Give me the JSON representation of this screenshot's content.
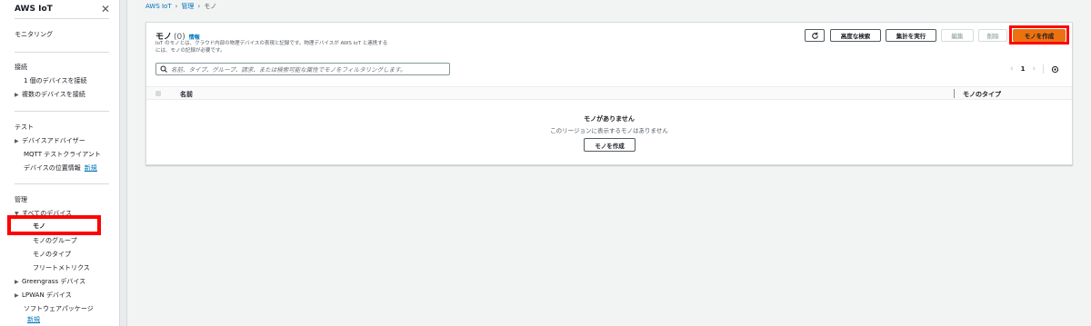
{
  "sidebar": {
    "title": "AWS IoT",
    "monitoring": "モニタリング",
    "connect": {
      "heading": "接続",
      "items": [
        "1 個のデバイスを接続",
        "複数のデバイスを接続"
      ]
    },
    "test": {
      "heading": "テスト",
      "items": [
        "デバイスアドバイザー",
        "MQTT テストクライアント",
        "デバイスの位置情報"
      ],
      "new_badge": "新規"
    },
    "manage": {
      "heading": "管理",
      "all_devices": "すべてのデバイス",
      "sub_items": [
        "モノ",
        "モノのグループ",
        "モノのタイプ",
        "フリートメトリクス"
      ],
      "greengrass": "Greengrass デバイス",
      "lpwan": "LPWAN デバイス",
      "software": "ソフトウェアパッケージ",
      "software_new": "新規"
    }
  },
  "breadcrumb": {
    "items": [
      "AWS IoT",
      "管理"
    ],
    "current": "モノ"
  },
  "panel": {
    "title": "モノ",
    "count": "(0)",
    "info": "情報",
    "desc_line1": "IoT のモノとは、クラウド内部の物理デバイスの表現と記録です。物理デバイスが AWS IoT と連携する",
    "desc_line2": "には、モノの記録が必要です。",
    "buttons": {
      "advanced_search": "高度な検索",
      "run_aggregation": "集計を実行",
      "edit": "編集",
      "delete": "削除",
      "create": "モノを作成"
    },
    "search_placeholder": "名前、タイプ、グループ、請求、または検索可能な属性でモノをフィルタリングします。",
    "pager": {
      "page": "1"
    },
    "columns": {
      "name": "名前",
      "type": "モノのタイプ"
    },
    "empty": {
      "title": "モノがありません",
      "subtitle": "このリージョンに表示するモノはありません",
      "button": "モノを作成"
    }
  }
}
